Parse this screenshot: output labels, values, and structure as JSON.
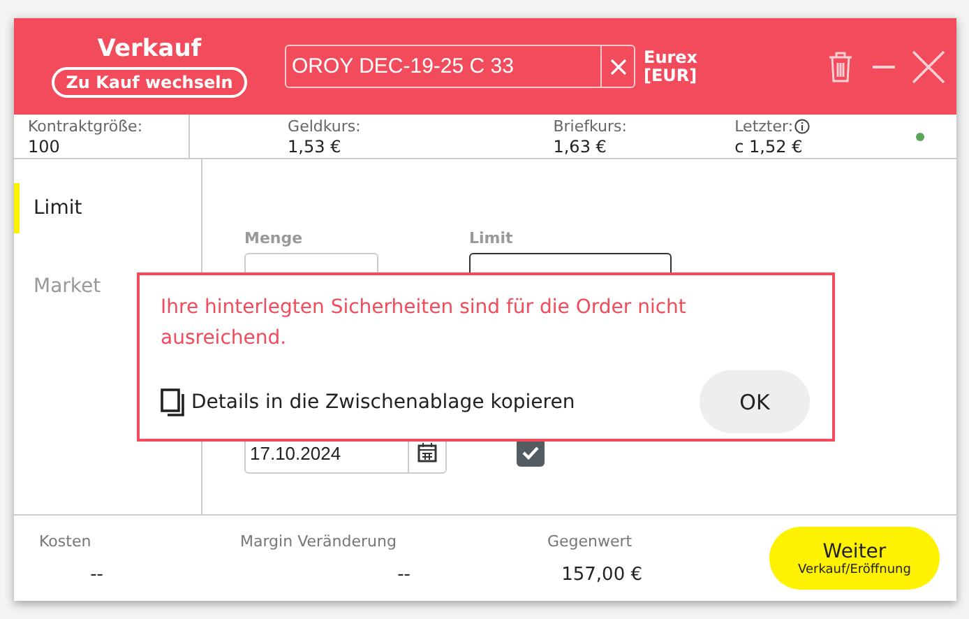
{
  "header": {
    "title": "Verkauf",
    "switch_button": "Zu Kauf wechseln",
    "instrument": {
      "value": "OROY DEC-19-25 C 33"
    },
    "exchange": "Eurex",
    "currency": "[EUR]"
  },
  "info": [
    {
      "kind": "plain",
      "label": "Kontraktgröße:",
      "value": "100"
    },
    {
      "kind": "plain",
      "label": "Geldkurs:",
      "value": "1,53 €"
    },
    {
      "kind": "plain",
      "label": "Briefkurs:",
      "value": "1,63 €"
    },
    {
      "kind": "with_info",
      "label": "Letzter:",
      "value": "c 1,52 €"
    }
  ],
  "order_types": [
    {
      "label": "Limit",
      "selected": true
    },
    {
      "label": "Market",
      "selected": false
    }
  ],
  "form": {
    "fields": [
      {
        "label": "Menge"
      },
      {
        "label": "Limit"
      }
    ],
    "date": {
      "value": "17.10.2024"
    },
    "checkbox": {
      "checked": true
    }
  },
  "dialog": {
    "message": "Ihre hinterlegten Sicherheiten sind für die Order nicht ausreichend.",
    "copy_link": "Details in die Zwischenablage kopieren",
    "ok_button": "OK"
  },
  "footer": {
    "summary": [
      {
        "label": "Kosten",
        "value": "--"
      },
      {
        "label": "Margin Veränderung",
        "value": "--"
      },
      {
        "label": "Gegenwert",
        "value": "157,00 €"
      }
    ],
    "next_button": {
      "label": "Weiter",
      "sublabel": "Verkauf/Eröffnung"
    }
  }
}
